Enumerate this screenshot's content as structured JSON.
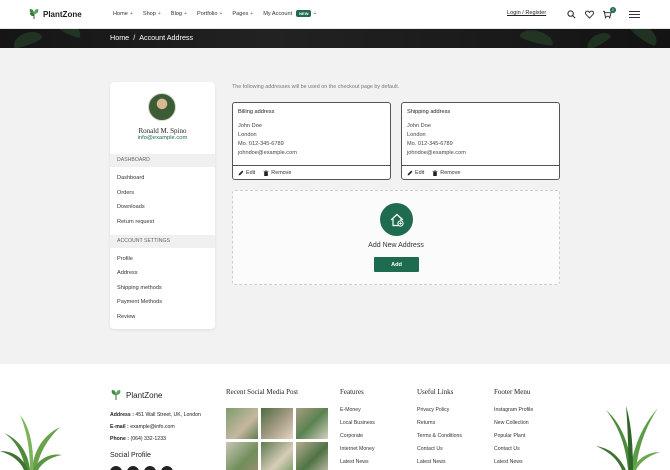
{
  "brand": {
    "name": "PlantZone"
  },
  "nav": {
    "items": [
      {
        "label": "Home",
        "caret": "+"
      },
      {
        "label": "Shop",
        "caret": "+"
      },
      {
        "label": "Blog",
        "caret": "+"
      },
      {
        "label": "Portfolio",
        "caret": "+"
      },
      {
        "label": "Pages",
        "caret": "+"
      },
      {
        "label": "My Account",
        "badge": "NEW",
        "caret": "+"
      }
    ],
    "login": "Login / Register",
    "cart_count": "0",
    "icons": [
      "search-icon",
      "heart-icon",
      "cart-icon",
      "menu-icon"
    ]
  },
  "breadcrumb": {
    "home": "Home",
    "sep": "/",
    "current": "Account Address"
  },
  "profile": {
    "name": "Ronald M. Spino",
    "email": "info@example.com"
  },
  "sidebar": {
    "dashboard_header": "DASHBOARD",
    "dashboard_links": [
      "Dashboard",
      "Orders",
      "Downloads",
      "Return request"
    ],
    "settings_header": "ACCOUNT SETTINGS",
    "settings_links": [
      "Profile",
      "Address",
      "Shipping methods",
      "Payment Methods",
      "Review"
    ]
  },
  "addresses": {
    "intro": "The following addresses will be used on the checkout page by default.",
    "billing": {
      "title": "Billing address",
      "name": "John Doe",
      "city": "London",
      "phone": "Mo. 012-345-6789",
      "email": "johndoe@example.com",
      "edit": "Edit",
      "remove": "Remove"
    },
    "shipping": {
      "title": "Shipping address",
      "name": "John Doe",
      "city": "London",
      "phone": "Mo. 012-345-6789",
      "email": "johndoe@example.com",
      "edit": "Edit",
      "remove": "Remove"
    },
    "new_label": "Add New Address",
    "add_button": "Add"
  },
  "footer": {
    "brand": "PlantZone",
    "address_label": "Address :",
    "address": "451 Wall Street, UK, London",
    "email_label": "E-mail :",
    "email": "example@info.com",
    "phone_label": "Phone :",
    "phone": "(064) 332-1233",
    "social_title": "Social Profile",
    "recent_title": "Recent Social Media Post",
    "features": {
      "title": "Features",
      "links": [
        "E-Money",
        "Local Business",
        "Corporate",
        "Internet Money",
        "Latest News"
      ]
    },
    "useful": {
      "title": "Useful Links",
      "links": [
        "Privacy Policy",
        "Returns",
        "Terms & Conditions",
        "Contact Us",
        "Latest News"
      ]
    },
    "menu": {
      "title": "Footer Menu",
      "links": [
        "Instagram Profile",
        "New Collection",
        "Popular Plant",
        "Contact Us",
        "Latest News"
      ]
    }
  },
  "colors": {
    "accent": "#1e6b4f",
    "banner": "#1b1b1b",
    "page_bg": "#f2f2f2"
  }
}
